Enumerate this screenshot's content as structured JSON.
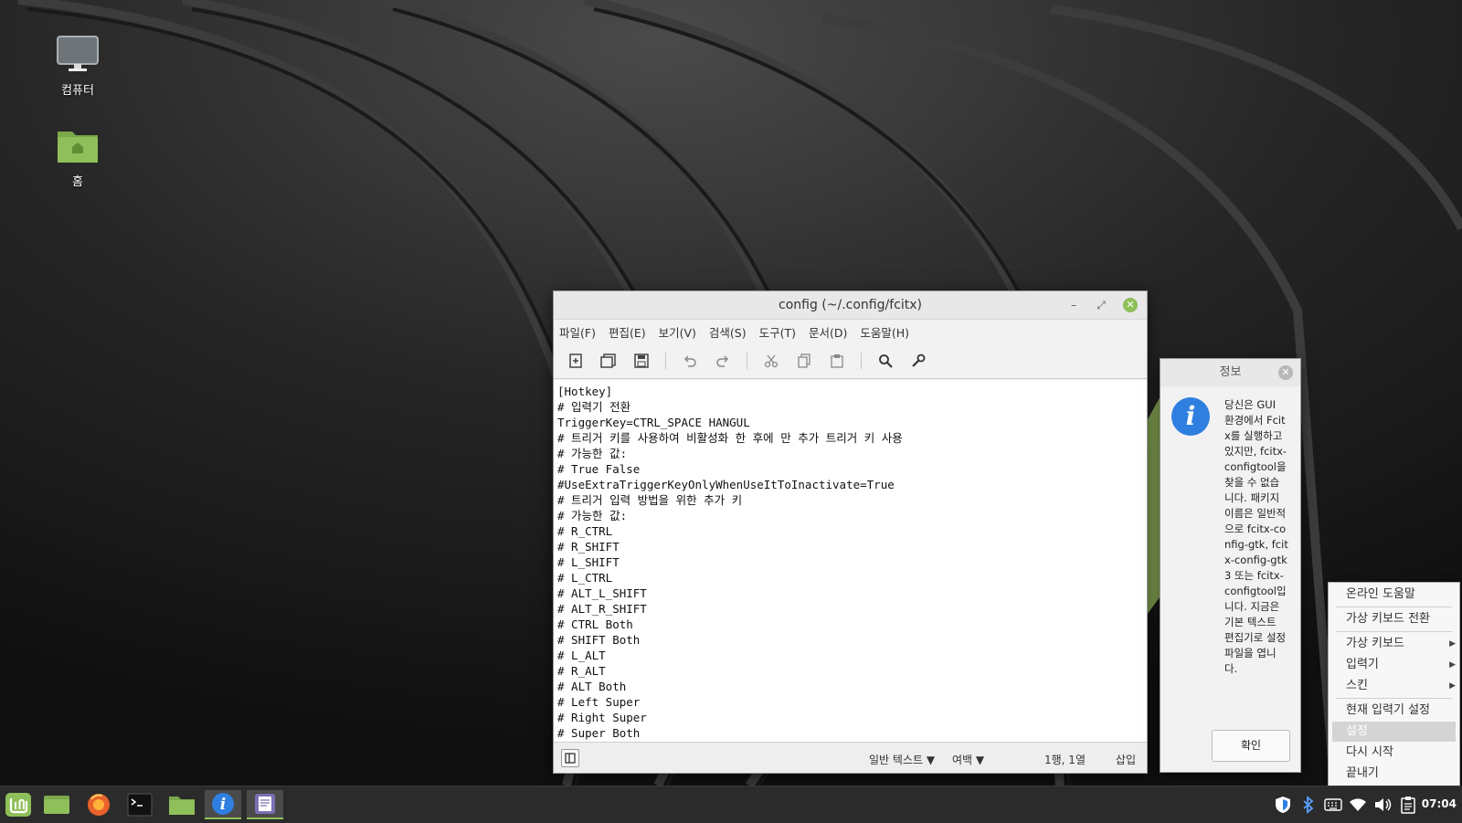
{
  "desktop": {
    "icons": [
      {
        "label": "컴퓨터"
      },
      {
        "label": "홈"
      }
    ]
  },
  "editor": {
    "title": "config (~/.config/fcitx)",
    "menu": [
      "파일(F)",
      "편집(E)",
      "보기(V)",
      "검색(S)",
      "도구(T)",
      "문서(D)",
      "도움말(H)"
    ],
    "toolbar_icons": [
      "new-document-icon",
      "open-document-icon",
      "save-icon",
      "undo-icon",
      "redo-icon",
      "cut-icon",
      "copy-icon",
      "paste-icon",
      "search-icon",
      "tools-icon"
    ],
    "lines": [
      "[Hotkey]",
      "# 입력기 전환",
      "TriggerKey=CTRL_SPACE HANGUL",
      "# 트리거 키를 사용하여 비활성화 한 후에 만 추가 트리거 키 사용",
      "# 가능한 값:",
      "# True False",
      "#UseExtraTriggerKeyOnlyWhenUseItToInactivate=True",
      "# 트리거 입력 방법을 위한 추가 키",
      "# 가능한 값:",
      "# R_CTRL",
      "# R_SHIFT",
      "# L_SHIFT",
      "# L_CTRL",
      "# ALT_L_SHIFT",
      "# ALT_R_SHIFT",
      "# CTRL Both",
      "# SHIFT Both",
      "# L_ALT",
      "# R_ALT",
      "# ALT Both",
      "# Left Super",
      "# Right Super",
      "# Super Both"
    ],
    "status": {
      "syntax": "일반 텍스트",
      "tab": "여백",
      "position": "1행, 1열",
      "mode": "삽입"
    }
  },
  "dialog": {
    "title": "정보",
    "message": "당신은 GUI 환경에서 Fcitx를 실행하고 있지만, fcitx-configtool을 찾을 수 없습니다. 패키지 이름은 일반적으로 fcitx-config-gtk, fcitx-config-gtk3 또는 fcitx-configtool입니다. 지금은 기본 텍스트 편집기로 설정 파일을 엽니다.",
    "ok": "확인"
  },
  "context_menu": {
    "items": [
      {
        "label": "온라인 도움말"
      },
      {
        "label": "가상 키보드 전환"
      },
      {
        "label": "가상 키보드",
        "submenu": true
      },
      {
        "label": "입력기",
        "submenu": true
      },
      {
        "label": "스킨",
        "submenu": true
      },
      {
        "label": "현재 입력기 설정"
      },
      {
        "label": "설정",
        "selected": true
      },
      {
        "label": "다시 시작"
      },
      {
        "label": "끝내기"
      }
    ]
  },
  "panel": {
    "clock": "07:04",
    "apps": [
      "mint-menu-icon",
      "show-desktop-icon",
      "firefox-icon",
      "terminal-icon",
      "files-icon",
      "info-icon",
      "text-editor-icon"
    ],
    "tray": [
      "shield-icon",
      "bluetooth-icon",
      "keyboard-icon",
      "wifi-icon",
      "volume-icon",
      "clipboard-icon"
    ]
  },
  "colors": {
    "accent": "#8fbf5a",
    "info_blue": "#2f7fe0",
    "panel": "#2b2b2b"
  }
}
